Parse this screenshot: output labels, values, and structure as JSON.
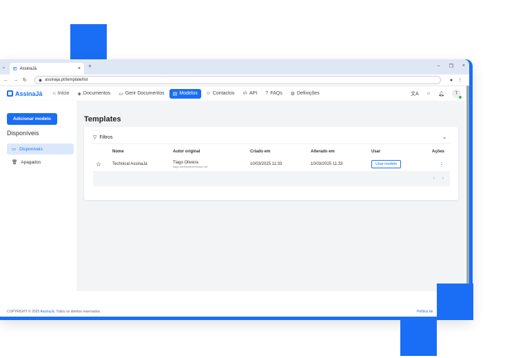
{
  "browser": {
    "tab_title": "AssinaJá",
    "tab_close": "×",
    "new_tab": "+",
    "url": "assinaja.pt/template/list",
    "window_controls": [
      "–",
      "❐",
      "×"
    ]
  },
  "nav": {
    "brand": "AssinaJá",
    "items": [
      {
        "label": "Início",
        "icon": "home-icon"
      },
      {
        "label": "Documentos",
        "icon": "documents-icon"
      },
      {
        "label": "Gerir Documentos",
        "icon": "folder-icon"
      },
      {
        "label": "Modelos",
        "icon": "template-icon",
        "active": true
      },
      {
        "label": "Contactos",
        "icon": "contacts-icon"
      },
      {
        "label": "API",
        "icon": "code-icon"
      },
      {
        "label": "FAQs",
        "icon": "help-icon"
      },
      {
        "label": "Definições",
        "icon": "gear-icon"
      }
    ],
    "avatar_initial": "T"
  },
  "sidebar": {
    "add_button": "Adicionar modelo",
    "section_title": "Disponíveis",
    "items": [
      {
        "label": "Disponíveis",
        "active": true
      },
      {
        "label": "Apagados",
        "active": false
      }
    ]
  },
  "main": {
    "title": "Templates",
    "filters_label": "Filtros",
    "columns": [
      "Nome",
      "Autor original",
      "Criado em",
      "Alterado em",
      "Usar",
      "Ações"
    ],
    "rows": [
      {
        "name": "Technical AssinaJá",
        "author": "Tiago Oliveira",
        "author_email": "tiago.oliveira@devscope.net",
        "created": "10/03/2025 11:33",
        "modified": "10/03/2025 11:33",
        "use_label": "Usar modelo",
        "actions": "⋮"
      }
    ]
  },
  "footer": {
    "copyright_prefix": "COPYRIGHT © 2025 ",
    "brand_link": "AssinaJá",
    "copyright_suffix": ", Todos os direitos reservados.",
    "policy": "Política de"
  },
  "colors": {
    "accent": "#1a6ef5",
    "background": "#f3f4f6"
  }
}
